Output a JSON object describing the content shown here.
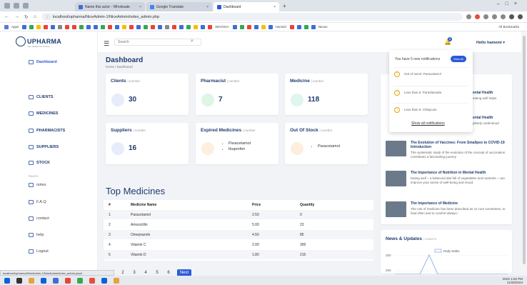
{
  "browser": {
    "tabs": [
      {
        "label": "Name this actor - Wholesale",
        "active": false
      },
      {
        "label": "Google Translate",
        "active": false
      },
      {
        "label": "Dashboard",
        "active": true
      }
    ],
    "url": "localhost/upharma/NiceAdmin-1/NiceAdmin/index_admin.php",
    "bookmarks": {
      "apps": "Apps",
      "text1": "IMAGGIA",
      "text2": "Homsid",
      "text3": "Nexus",
      "all": "All Bookmarks"
    }
  },
  "app": {
    "logo": "UPHARMA",
    "logo_sub": "Your Health Our Priority",
    "search_placeholder": "Search",
    "user": "Hello hamemi",
    "notif_count": "5"
  },
  "sidebar": {
    "dashboard": "Dashboard",
    "clients": "CLIENTS",
    "medicines": "MEDICINES",
    "pharmacists": "PHARMACISTS",
    "suppliers": "SUPPLIERS",
    "stock": "STOCK",
    "pages": "PAGES",
    "notes": "notes",
    "faq": "F.A.Q",
    "contact": "contact",
    "help": "help",
    "logout": "Logout"
  },
  "page": {
    "title": "Dashboard",
    "breadcrumb": "Home / Dashboard"
  },
  "cards": {
    "clients": {
      "title": "Clients",
      "sub": "| number",
      "value": "30"
    },
    "pharmacist": {
      "title": "Pharmacist",
      "sub": "| number",
      "value": "7"
    },
    "medicine": {
      "title": "Medicine",
      "sub": "| number",
      "value": "118"
    },
    "suppliers": {
      "title": "Suppliers",
      "sub": "| number",
      "value": "16"
    },
    "expired": {
      "title": "Expired Medicines",
      "sub": "| number",
      "items": [
        "Paracetamol",
        "Ibuprofen"
      ]
    },
    "outofstock": {
      "title": "Out Of Stock",
      "sub": "| number",
      "items": [
        "Paracetamol"
      ]
    }
  },
  "top_medicines": {
    "title": "Top Medicines",
    "headers": [
      "#",
      "Medicine Name",
      "Price",
      "Quantity"
    ],
    "rows": [
      [
        "1",
        "Paracetamol",
        "2.50",
        "0"
      ],
      [
        "2",
        "Amoxicillin",
        "5.00",
        "23"
      ],
      [
        "3",
        "Omeprazole",
        "4.50",
        "85"
      ],
      [
        "4",
        "Vitamin C",
        "2.00",
        "300"
      ],
      [
        "5",
        "Vitamin D",
        "1.80",
        "215"
      ]
    ],
    "pages": [
      "1",
      "2",
      "3",
      "4",
      "5",
      "6"
    ],
    "next": "Next"
  },
  "notifications": {
    "header": "You have 5 new notifications",
    "view_all": "View all",
    "items": [
      "Out of stock: Paracetamol",
      "Less than 5: Parasfamahe",
      "Less than 5: Chlaycuin"
    ],
    "show_all": "Show all notifications"
  },
  "news": {
    "frag1": "ental Health",
    "frag1b": "eating well helps",
    "frag2": "ental Health",
    "frag2b": "pletely understood",
    "items": [
      {
        "title": "The Evolution of Vaccines: From Smallpox to COVID-19 Introduction",
        "text": "The systematic study of the evolution of the concept of vaccination constitutes a fascinating journey"
      },
      {
        "title": "The Importance of Nutrition in Mental Health",
        "text": "Eating well – a balanced diet full of vegetables and nutrients – can improve your sense of well-being and mood."
      },
      {
        "title": "The Importance of Medicine",
        "text": "The role of medicine has been described as 'to cure sometimes, to heal often and to comfort always.'"
      }
    ]
  },
  "updates": {
    "title": "News & Updates",
    "sub": "| CHARTS",
    "legend": "Daily Sales",
    "ticks": [
      "300",
      "250"
    ]
  },
  "status_url": "localhost/upharma/NiceAdmin-1/NiceAdmin/index_admin.php#",
  "tray": {
    "time": "1:52 PM",
    "date": "11/26/2024",
    "lang": "ENG"
  },
  "colors": {
    "primary": "#2a5bd7",
    "navy": "#1f3b70",
    "warning": "#e4a40b"
  }
}
